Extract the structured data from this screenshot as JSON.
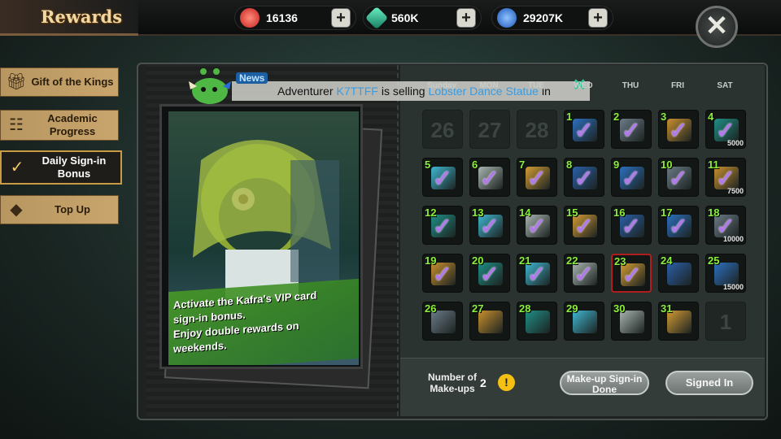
{
  "header": {
    "title": "Rewards",
    "currencies": [
      {
        "name": "ruby",
        "amount": "16136",
        "color": "#e2423f"
      },
      {
        "name": "crystal",
        "amount": "560K",
        "color": "#2fc39a"
      },
      {
        "name": "coin",
        "amount": "29207K",
        "color": "#3b86e8"
      }
    ],
    "close_label": "✕"
  },
  "sidebar": {
    "items": [
      {
        "label": "Gift of the Kings",
        "icon": "gift-icon"
      },
      {
        "label": "Academic Progress",
        "icon": "clipboard-icon"
      },
      {
        "label": "Daily Sign-in Bonus",
        "icon": "checkmark-icon",
        "active": true
      },
      {
        "label": "Top Up",
        "icon": "diamond-icon"
      }
    ]
  },
  "news": {
    "tag": "News",
    "prefix": "Adventurer",
    "player": "K7TTFF",
    "middle": "is selling",
    "item": "Lobster Dance Statue",
    "suffix": "in"
  },
  "card": {
    "lines": [
      "Activate the Kafra's VIP card",
      "sign-in bonus.",
      "Enjoy double rewards on",
      "weekends."
    ]
  },
  "calendar": {
    "weekdays": [
      "Sunday",
      "MON",
      "TUE",
      "WED",
      "THU",
      "FRI",
      "SAT"
    ],
    "prev_month_days": [
      "26",
      "27",
      "28"
    ],
    "next_month_days": [
      "1"
    ],
    "days": [
      {
        "day": "1",
        "signed": true
      },
      {
        "day": "2",
        "signed": true
      },
      {
        "day": "3",
        "signed": true
      },
      {
        "day": "4",
        "signed": true,
        "amount": "5000"
      },
      {
        "day": "5",
        "signed": true
      },
      {
        "day": "6",
        "signed": true
      },
      {
        "day": "7",
        "signed": true
      },
      {
        "day": "8",
        "signed": true
      },
      {
        "day": "9",
        "signed": true
      },
      {
        "day": "10",
        "signed": true
      },
      {
        "day": "11",
        "signed": true,
        "amount": "7500"
      },
      {
        "day": "12",
        "signed": true
      },
      {
        "day": "13",
        "signed": true
      },
      {
        "day": "14",
        "signed": true
      },
      {
        "day": "15",
        "signed": true
      },
      {
        "day": "16",
        "signed": true
      },
      {
        "day": "17",
        "signed": true
      },
      {
        "day": "18",
        "signed": true,
        "amount": "10000"
      },
      {
        "day": "19",
        "signed": true
      },
      {
        "day": "20",
        "signed": true
      },
      {
        "day": "21",
        "signed": true
      },
      {
        "day": "22",
        "signed": true
      },
      {
        "day": "23",
        "signed": true,
        "today": true
      },
      {
        "day": "24",
        "signed": false
      },
      {
        "day": "25",
        "signed": false,
        "amount": "15000"
      },
      {
        "day": "26",
        "signed": false
      },
      {
        "day": "27",
        "signed": false
      },
      {
        "day": "28",
        "signed": false
      },
      {
        "day": "29",
        "signed": false
      },
      {
        "day": "30",
        "signed": false
      },
      {
        "day": "31",
        "signed": false
      }
    ]
  },
  "footer": {
    "makeups_label": "Number of Make-ups",
    "makeups_count": "2",
    "warn_icon": "!",
    "makeup_button": "Make-up Sign-in Done",
    "signed_button": "Signed In"
  }
}
